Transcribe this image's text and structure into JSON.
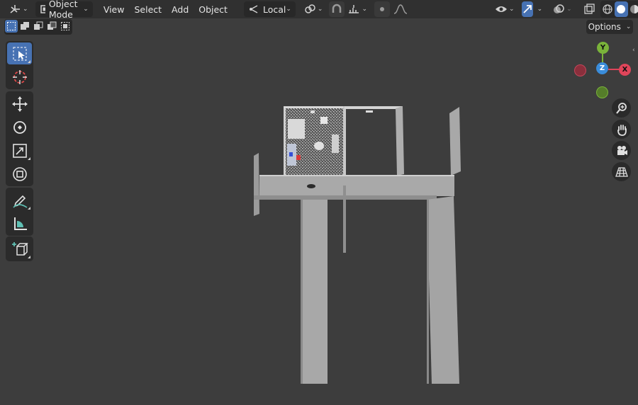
{
  "header": {
    "mode_label": "Object Mode",
    "menus": [
      "View",
      "Select",
      "Add",
      "Object"
    ],
    "transform_orientation": "Local"
  },
  "options_label": "Options",
  "gizmo": {
    "y_label": "Y",
    "z_label": "Z",
    "x_label": "X"
  },
  "colors": {
    "accent": "#4772b3",
    "x_axis": "#e0455a",
    "y_axis": "#7ab33a",
    "z_axis": "#3a8ddb",
    "viewport_bg": "#3d3d3d"
  },
  "icons": {
    "toolbar": [
      "select-box-icon",
      "cursor-icon",
      "move-icon",
      "rotate-icon",
      "scale-icon",
      "transform-icon",
      "annotate-icon",
      "measure-icon",
      "add-cube-icon"
    ],
    "nav": [
      "zoom-icon",
      "hand-pan-icon",
      "camera-icon",
      "perspective-grid-icon"
    ]
  }
}
